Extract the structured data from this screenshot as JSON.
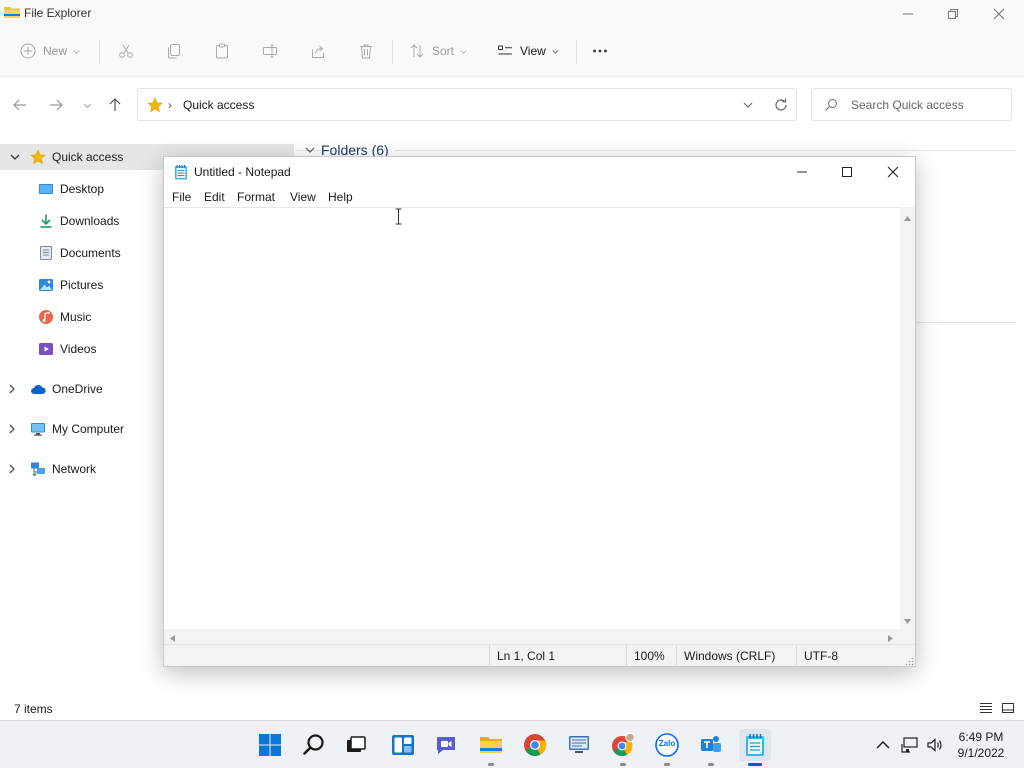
{
  "explorer": {
    "title": "File Explorer",
    "toolbar": {
      "new_label": "New",
      "sort_label": "Sort",
      "view_label": "View"
    },
    "address": {
      "crumb": "Quick access"
    },
    "search": {
      "placeholder": "Search Quick access"
    },
    "nav": {
      "quick_access": "Quick access",
      "items": [
        {
          "label": "Desktop",
          "icon": "desktop-icon"
        },
        {
          "label": "Downloads",
          "icon": "downloads-icon"
        },
        {
          "label": "Documents",
          "icon": "documents-icon"
        },
        {
          "label": "Pictures",
          "icon": "pictures-icon"
        },
        {
          "label": "Music",
          "icon": "music-icon"
        },
        {
          "label": "Videos",
          "icon": "videos-icon"
        }
      ],
      "onedrive": "OneDrive",
      "my_computer": "My Computer",
      "network": "Network"
    },
    "content": {
      "folders_header": "Folders (6)"
    },
    "status": {
      "item_count": "7 items"
    }
  },
  "notepad": {
    "title": "Untitled - Notepad",
    "menu": [
      "File",
      "Edit",
      "Format",
      "View",
      "Help"
    ],
    "content": "",
    "status": {
      "position": "Ln 1, Col 1",
      "zoom": "100%",
      "line_endings": "Windows (CRLF)",
      "encoding": "UTF-8"
    }
  },
  "taskbar": {
    "apps": [
      "start",
      "search",
      "task-view",
      "widgets",
      "chat",
      "file-explorer",
      "chrome",
      "remote-desktop",
      "chrome-profile",
      "zalo",
      "teams",
      "notepad"
    ],
    "zalo_label": "Zalo",
    "clock": {
      "time": "6:49 PM",
      "date": "9/1/2022"
    }
  },
  "colors": {
    "accent": "#005fb8",
    "folder_yellow": "#f2c13c",
    "star_yellow": "#f5b800",
    "onedrive_blue": "#0a64c8"
  }
}
